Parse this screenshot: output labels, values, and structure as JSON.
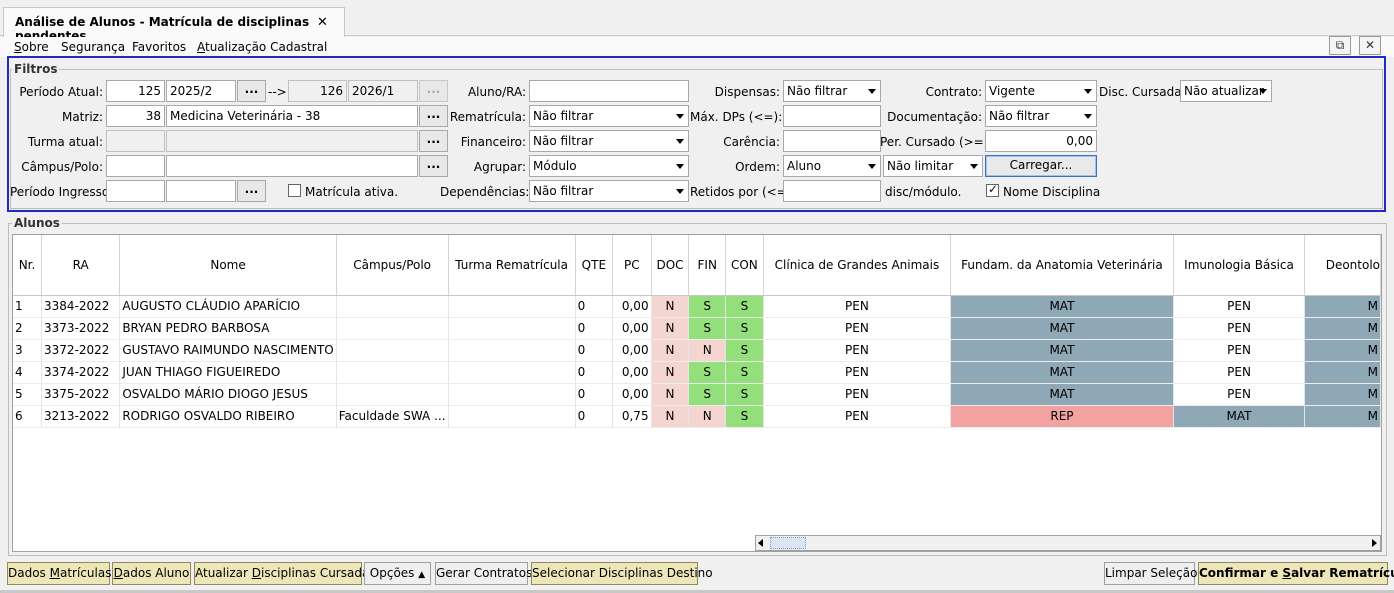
{
  "tab": {
    "title": "Análise de Alunos - Matrícula de disciplinas pendentes",
    "close": "✕"
  },
  "menu": {
    "sobre": {
      "u": "S",
      "rest": "obre"
    },
    "seguranca": {
      "u": "",
      "rest": "Segurança"
    },
    "favoritos": {
      "u": "",
      "rest": "Favoritos"
    },
    "atualizacao": {
      "u": "A",
      "rest": "tualização Cadastral"
    }
  },
  "window_buttons": {
    "popout": "⧉",
    "close": "✕"
  },
  "filters": {
    "title": "Filtros",
    "periodo_atual_label": "Período Atual:",
    "periodo_atual_code": "125",
    "periodo_atual_value": "2025/2",
    "arrow": "-->",
    "periodo_dest_code": "126",
    "periodo_dest_value": "2026/1",
    "dots": "...",
    "matriz_label": "Matriz:",
    "matriz_code": "38",
    "matriz_value": "Medicina Veterinária - 38",
    "turma_label": "Turma atual:",
    "turma_code": "",
    "turma_value": "",
    "campus_label": "Câmpus/Polo:",
    "campus_code": "",
    "campus_value": "",
    "ingresso_label": "Período Ingresso:",
    "ingresso_code": "",
    "ingresso_value": "",
    "matricula_ativa_label": "Matrícula ativa.",
    "aluno_ra_label": "Aluno/RA:",
    "aluno_ra_value": "",
    "rematricula_label": "Rematrícula:",
    "rematricula_value": "Não filtrar",
    "financeiro_label": "Financeiro:",
    "financeiro_value": "Não filtrar",
    "agrupar_label": "Agrupar:",
    "agrupar_value": "Módulo",
    "dependencias_label": "Dependências:",
    "dependencias_value": "Não filtrar",
    "dispensas_label": "Dispensas:",
    "dispensas_value": "Não filtrar",
    "max_dps_label": "Máx. DPs (<=):",
    "max_dps_value": "",
    "carencia_label": "Carência:",
    "carencia_value": "",
    "ordem_label": "Ordem:",
    "ordem_value": "Aluno",
    "limitar_value": "Não limitar",
    "retidos_label": "Retidos por (<=):",
    "retidos_value": "",
    "disc_modulo_label": "disc/módulo.",
    "contrato_label": "Contrato:",
    "contrato_value": "Vigente",
    "documentacao_label": "Documentação:",
    "documentacao_value": "Não filtrar",
    "per_cursado_label": "Per. Cursado (>=):",
    "per_cursado_value": "0,00",
    "carregar_label": "Carregar...",
    "nome_disciplina_label": "Nome Disciplina",
    "disc_cursadas_label": "Disc. Cursadas:",
    "disc_cursadas_value": "Não atualizar"
  },
  "alunos": {
    "title": "Alunos",
    "columns": [
      "Nr.",
      "RA",
      "Nome",
      "Câmpus/Polo",
      "Turma Rematrícula",
      "QTE",
      "PC",
      "DOC",
      "FIN",
      "CON",
      "Clínica de Grandes Animais",
      "Fundam. da Anatomia Veterinária",
      "Imunologia Básica",
      "Deontolo"
    ],
    "rows": [
      [
        "1",
        "3384-2022",
        "AUGUSTO CLÁUDIO APARÍCIO",
        "",
        "",
        "0",
        "0,00",
        "N",
        "S",
        "S",
        "PEN",
        "MAT",
        "PEN",
        "M"
      ],
      [
        "2",
        "3373-2022",
        "BRYAN PEDRO BARBOSA",
        "",
        "",
        "0",
        "0,00",
        "N",
        "S",
        "S",
        "PEN",
        "MAT",
        "PEN",
        "M"
      ],
      [
        "3",
        "3372-2022",
        "GUSTAVO RAIMUNDO NASCIMENTO",
        "",
        "",
        "0",
        "0,00",
        "N",
        "N",
        "S",
        "PEN",
        "MAT",
        "PEN",
        "M"
      ],
      [
        "4",
        "3374-2022",
        "JUAN THIAGO FIGUEIREDO",
        "",
        "",
        "0",
        "0,00",
        "N",
        "S",
        "S",
        "PEN",
        "MAT",
        "PEN",
        "M"
      ],
      [
        "5",
        "3375-2022",
        "OSVALDO MÁRIO DIOGO JESUS",
        "",
        "",
        "0",
        "0,00",
        "N",
        "S",
        "S",
        "PEN",
        "MAT",
        "PEN",
        "M"
      ],
      [
        "6",
        "3213-2022",
        "RODRIGO OSVALDO RIBEIRO",
        "Faculdade SWA ...",
        "",
        "0",
        "0,75",
        "N",
        "N",
        "S",
        "PEN",
        "REP",
        "MAT",
        "M"
      ]
    ]
  },
  "bottom": {
    "dados_matriculas": {
      "a": "Dados ",
      "u": "M",
      "b": "atrículas"
    },
    "dados_aluno": {
      "a": "",
      "u": "D",
      "b": "ados Aluno"
    },
    "atualizar": {
      "a": "Atualizar ",
      "u": "D",
      "b": "isciplinas Cursadas"
    },
    "opcoes": "Opções",
    "gerar_contratos": "Gerar Contratos",
    "selecionar": "Selecionar Disciplinas Destino",
    "limpar": "Limpar Seleção",
    "confirmar": {
      "a": "Confirmar e ",
      "u": "S",
      "b": "alvar Rematrículas"
    }
  }
}
